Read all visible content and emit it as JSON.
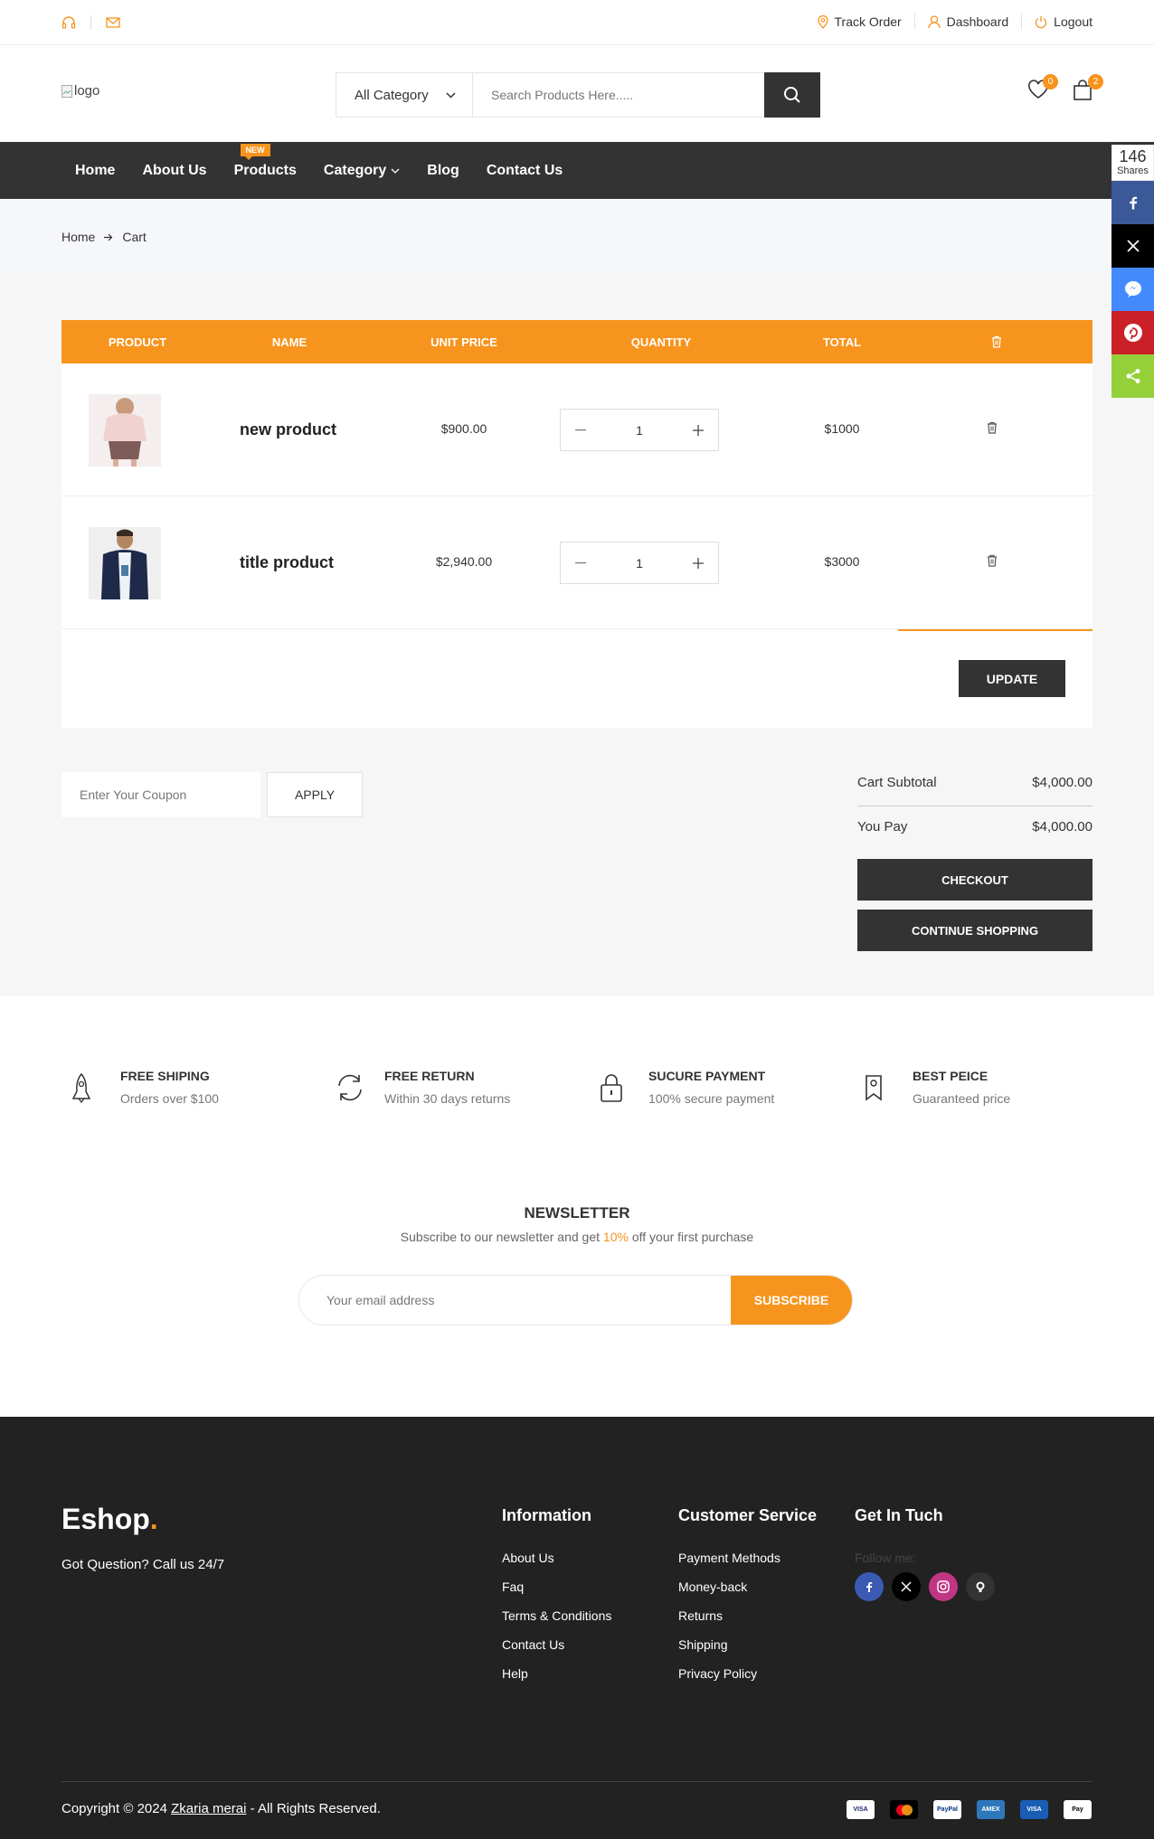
{
  "topbar": {
    "track": "Track Order",
    "dashboard": "Dashboard",
    "logout": "Logout"
  },
  "header": {
    "logo_alt": "logo",
    "category": "All Category",
    "search_placeholder": "Search Products Here.....",
    "wishlist_count": "0",
    "cart_count": "2"
  },
  "nav": {
    "items": [
      "Home",
      "About Us",
      "Products",
      "Category",
      "Blog",
      "Contact Us"
    ],
    "new_tag": "NEW"
  },
  "breadcrumb": {
    "home": "Home",
    "current": "Cart"
  },
  "cart": {
    "headers": [
      "PRODUCT",
      "NAME",
      "UNIT PRICE",
      "QUANTITY",
      "TOTAL"
    ],
    "rows": [
      {
        "name": "new product",
        "unit_price": "$900.00",
        "qty": "1",
        "total": "$1000"
      },
      {
        "name": "title product",
        "unit_price": "$2,940.00",
        "qty": "1",
        "total": "$3000"
      }
    ],
    "update": "UPDATE",
    "coupon_placeholder": "Enter Your Coupon",
    "apply": "APPLY",
    "subtotal_label": "Cart Subtotal",
    "subtotal": "$4,000.00",
    "pay_label": "You Pay",
    "pay": "$4,000.00",
    "checkout": "CHECKOUT",
    "continue": "CONTINUE SHOPPING"
  },
  "services": [
    {
      "title": "FREE SHIPING",
      "sub": "Orders over $100",
      "icon": "rocket-icon"
    },
    {
      "title": "FREE RETURN",
      "sub": "Within 30 days returns",
      "icon": "refresh-icon"
    },
    {
      "title": "SUCURE PAYMENT",
      "sub": "100% secure payment",
      "icon": "lock-icon"
    },
    {
      "title": "BEST PEICE",
      "sub": "Guaranteed price",
      "icon": "tag-icon"
    }
  ],
  "newsletter": {
    "title": "NEWSLETTER",
    "text_before": "Subscribe to our newsletter and get ",
    "highlight": "10%",
    "text_after": " off your first purchase",
    "placeholder": "Your email address",
    "button": "SUBSCRIBE"
  },
  "footer": {
    "logo": "Eshop",
    "logo_dot": ".",
    "question": "Got Question? Call us 24/7",
    "info_title": "Information",
    "info": [
      "About Us",
      "Faq",
      "Terms & Conditions",
      "Contact Us",
      "Help"
    ],
    "cs_title": "Customer Service",
    "cs": [
      "Payment Methods",
      "Money-back",
      "Returns",
      "Shipping",
      "Privacy Policy"
    ],
    "touch_title": "Get In Tuch",
    "follow": "Follow me:",
    "copy_before": "Copyright © 2024 ",
    "copy_name": "Zkaria merai",
    "copy_after": " - All Rights Reserved.",
    "payments": [
      "VISA",
      "MC",
      "PayPal",
      "AMEX",
      "VISA",
      "Pay"
    ]
  },
  "share": {
    "count": "146",
    "label": "Shares"
  },
  "colors": {
    "accent": "#f7941d",
    "dark": "#333333",
    "footer": "#222222"
  }
}
